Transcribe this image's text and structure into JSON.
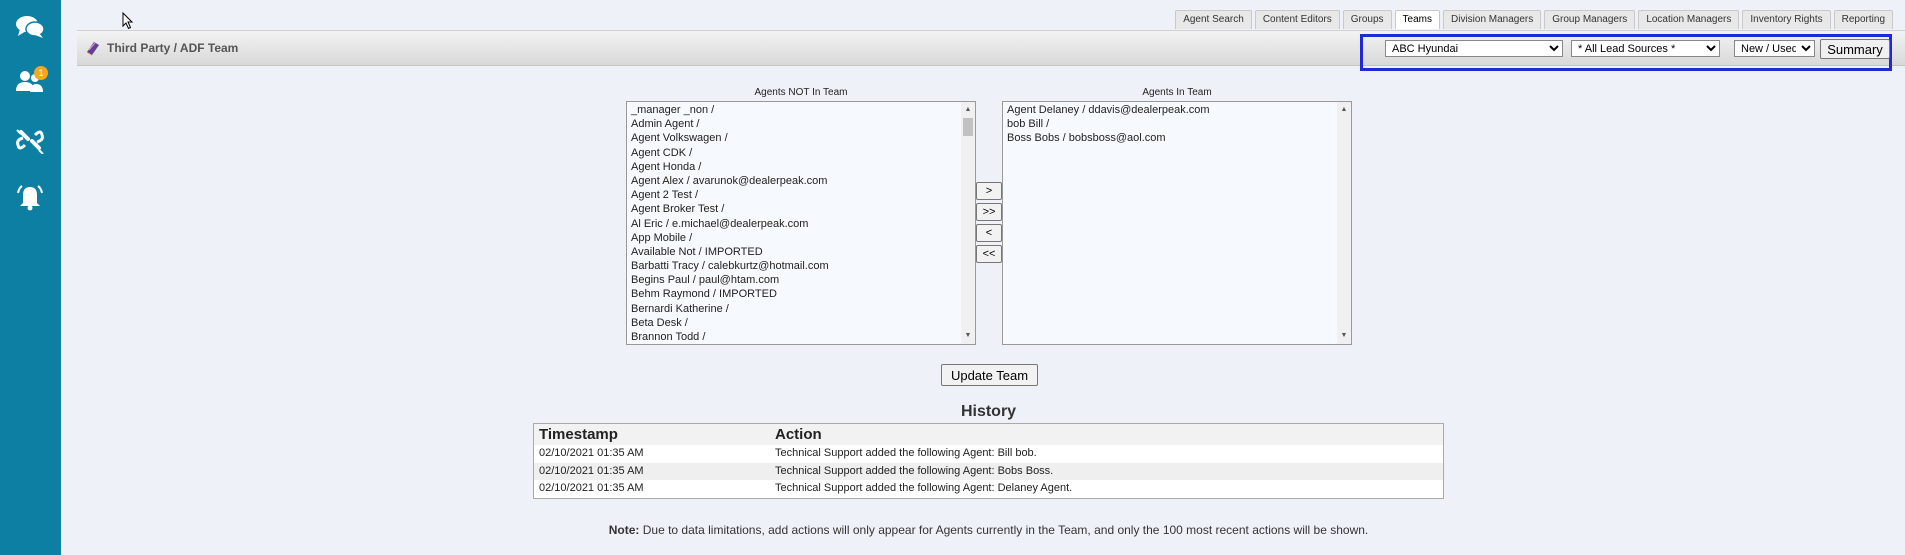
{
  "sidebar": {
    "items": [
      {
        "icon": "chat-icon"
      },
      {
        "icon": "users-icon",
        "badge": "1"
      },
      {
        "icon": "link-icon"
      },
      {
        "icon": "bell-icon"
      }
    ]
  },
  "tabs": [
    {
      "label": "Agent Search",
      "active": false
    },
    {
      "label": "Content Editors",
      "active": false
    },
    {
      "label": "Groups",
      "active": false
    },
    {
      "label": "Teams",
      "active": true
    },
    {
      "label": "Division Managers",
      "active": false
    },
    {
      "label": "Group Managers",
      "active": false
    },
    {
      "label": "Location Managers",
      "active": false
    },
    {
      "label": "Inventory Rights",
      "active": false
    },
    {
      "label": "Reporting",
      "active": false
    }
  ],
  "header": {
    "title": "Third Party / ADF Team",
    "dealer_select": "ABC Hyundai",
    "lead_source_select": "* All Lead Sources *",
    "condition_select": "New / Used",
    "summary_label": "Summary"
  },
  "agents_not_in_team": {
    "caption": "Agents NOT In Team",
    "items": [
      "_manager _non /",
      "Admin Agent /",
      "Agent Volkswagen /",
      "Agent CDK /",
      "Agent Honda /",
      "Agent Alex / avarunok@dealerpeak.com",
      "Agent 2 Test /",
      "Agent Broker Test /",
      "Al Eric / e.michael@dealerpeak.com",
      "App Mobile /",
      "Available Not / IMPORTED",
      "Barbatti Tracy / calebkurtz@hotmail.com",
      "Begins Paul / paul@htam.com",
      "Behm Raymond / IMPORTED",
      "Bernardi Katherine /",
      "Beta Desk /",
      "Brannon Todd /"
    ]
  },
  "agents_in_team": {
    "caption": "Agents In Team",
    "items": [
      "Agent Delaney / ddavis@dealerpeak.com",
      "bob Bill /",
      "Boss Bobs / bobsboss@aol.com"
    ]
  },
  "move_buttons": {
    "add_one": ">",
    "add_all": ">>",
    "remove_one": "<",
    "remove_all": "<<"
  },
  "update_label": "Update Team",
  "history": {
    "title": "History",
    "columns": [
      "Timestamp",
      "Action"
    ],
    "rows": [
      [
        "02/10/2021 01:35 AM",
        "Technical Support added the following Agent: Bill bob."
      ],
      [
        "02/10/2021 01:35 AM",
        "Technical Support added the following Agent: Bobs Boss."
      ],
      [
        "02/10/2021 01:35 AM",
        "Technical Support added the following Agent: Delaney Agent."
      ]
    ]
  },
  "note": {
    "label": "Note:",
    "text": " Due to data limitations, add actions will only appear for Agents currently in the Team, and only the 100 most recent actions will be shown."
  },
  "colors": {
    "rail": "#0d7fa3",
    "highlight_box": "#1f2ad6",
    "badge": "#f5a623"
  }
}
